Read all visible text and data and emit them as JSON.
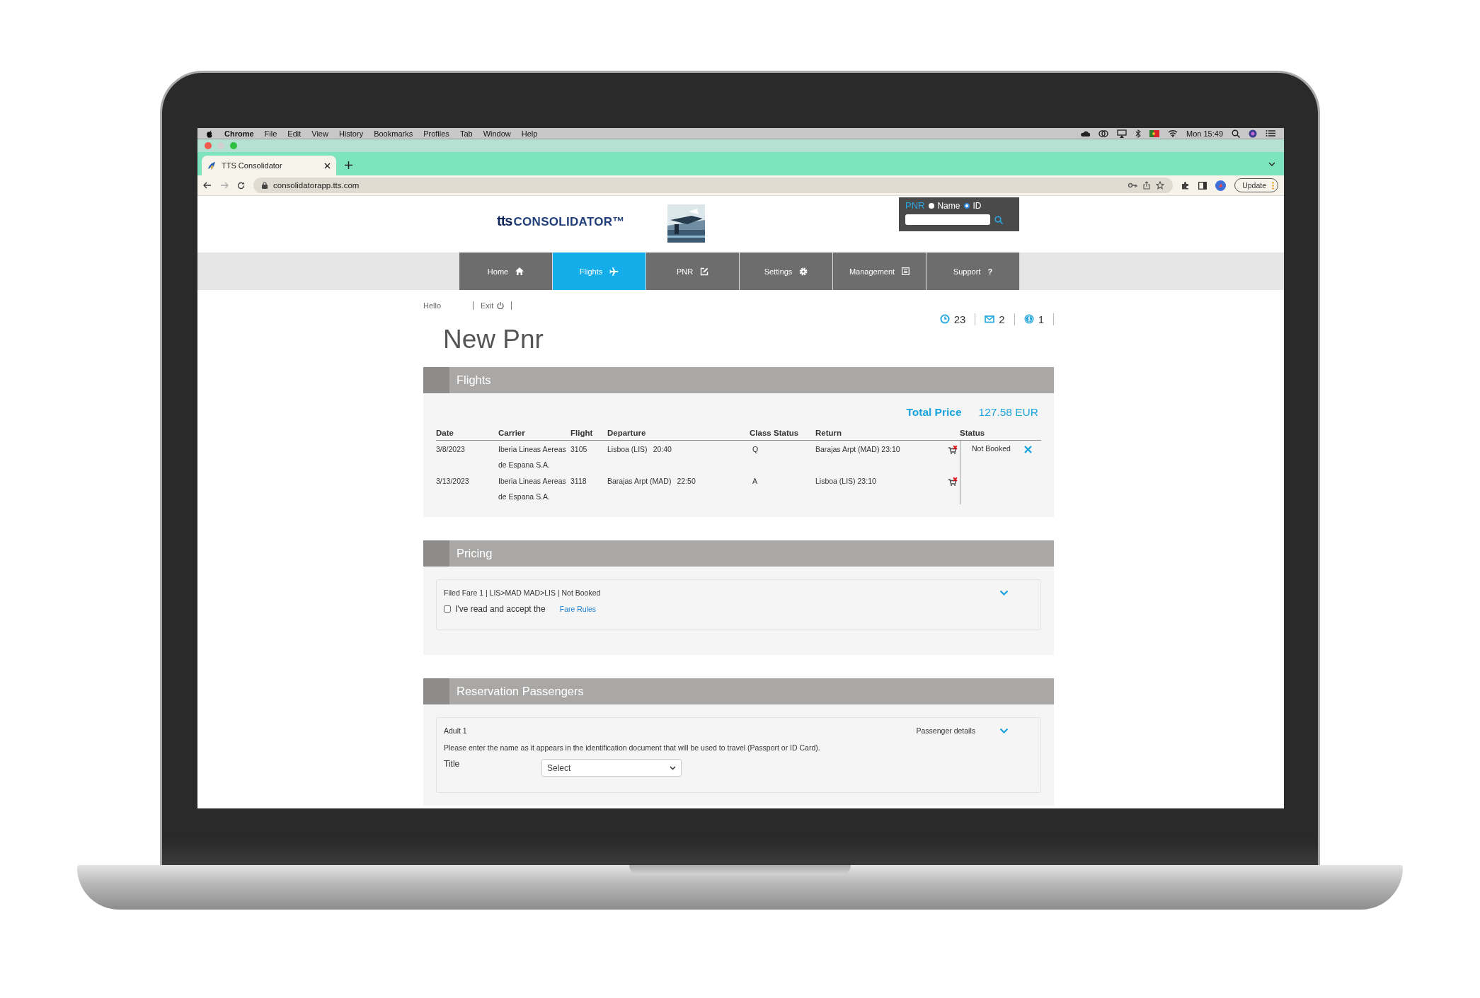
{
  "menubar": {
    "menus": [
      {
        "label": "Chrome",
        "bold": true
      },
      {
        "label": "File",
        "bold": false
      },
      {
        "label": "Edit",
        "bold": false
      },
      {
        "label": "View",
        "bold": false
      },
      {
        "label": "History",
        "bold": false
      },
      {
        "label": "Bookmarks",
        "bold": false
      },
      {
        "label": "Profiles",
        "bold": false
      },
      {
        "label": "Tab",
        "bold": false
      },
      {
        "label": "Window",
        "bold": false
      },
      {
        "label": "Help",
        "bold": false
      }
    ],
    "clock": "Mon 15:49"
  },
  "browser": {
    "tab": {
      "title": "TTS Consolidator"
    },
    "url": "consolidatorapp.tts.com",
    "update_button": "Update"
  },
  "header": {
    "logo": {
      "brand": "tts",
      "name": "CONSOLIDATOR™"
    },
    "search": {
      "label": "PNR",
      "options": [
        {
          "label": "Name",
          "selected": false
        },
        {
          "label": "ID",
          "selected": true
        }
      ]
    }
  },
  "nav": [
    {
      "label": "Home",
      "selected": false
    },
    {
      "label": "Flights",
      "selected": true
    },
    {
      "label": "PNR",
      "selected": false
    },
    {
      "label": "Settings",
      "selected": false
    },
    {
      "label": "Management",
      "selected": false
    },
    {
      "label": "Support",
      "selected": false,
      "glyph": "?"
    }
  ],
  "user_bar": {
    "greeting": "Hello",
    "exit": "Exit"
  },
  "page_title": "New Pnr",
  "counters": [
    "23",
    "2",
    "1"
  ],
  "flights": {
    "title": "Flights",
    "total_label": "Total Price",
    "total_value": "127.58 EUR",
    "columns": [
      "Date",
      "Carrier",
      "Flight",
      "Departure",
      "Class",
      "Status",
      "Return",
      "Status"
    ],
    "rows": [
      {
        "date": "3/8/2023",
        "carrier": "Iberia Lineas Aereas de Espana S.A.",
        "flight": "3105",
        "departure_place": "Lisboa (LIS)",
        "departure_time": "20:40",
        "class": "Q",
        "return": "Barajas Arpt (MAD) 23:10"
      },
      {
        "date": "3/13/2023",
        "carrier": "Iberia Lineas Aereas de Espana S.A.",
        "flight": "3118",
        "departure_place": "Barajas Arpt (MAD)",
        "departure_time": "22:50",
        "class": "A",
        "return": "Lisboa (LIS) 23:10"
      }
    ],
    "booking_status": "Not Booked"
  },
  "pricing": {
    "title": "Pricing",
    "fare": "Filed Fare 1 | LIS>MAD MAD>LIS | Not Booked",
    "accept_label": "I've read and accept the",
    "accepted": false,
    "link": "Fare Rules"
  },
  "passengers": {
    "title": "Reservation Passengers",
    "passenger": "Adult 1",
    "details_label": "Passenger details",
    "note": "Please enter the name as it appears in the identification document that will be used to travel (Passport or ID Card).",
    "fields": [
      {
        "label": "Title",
        "value": "Select"
      }
    ]
  }
}
